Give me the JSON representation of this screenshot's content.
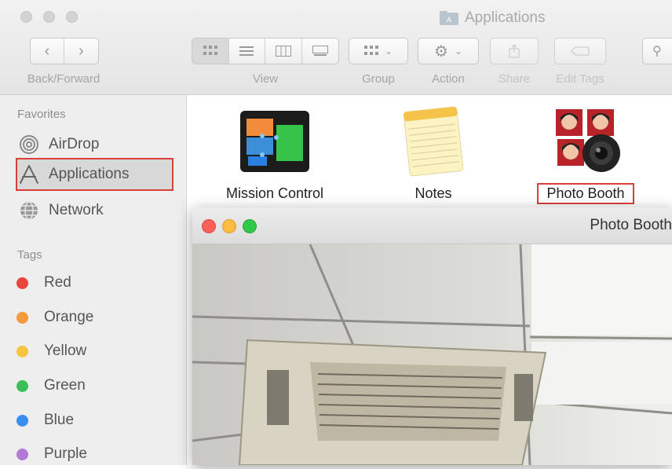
{
  "window": {
    "title": "Applications"
  },
  "toolbar": {
    "back_label": "Back/Forward",
    "view_label": "View",
    "group_label": "Group",
    "action_label": "Action",
    "share_label": "Share",
    "edit_tags_label": "Edit Tags"
  },
  "sidebar": {
    "favorites_header": "Favorites",
    "favorites": [
      {
        "label": "AirDrop",
        "icon": "airdrop-icon"
      },
      {
        "label": "Applications",
        "icon": "applications-icon"
      },
      {
        "label": "Network",
        "icon": "network-icon"
      }
    ],
    "tags_header": "Tags",
    "tags": [
      {
        "label": "Red",
        "color": "#e8453c"
      },
      {
        "label": "Orange",
        "color": "#f39a3d"
      },
      {
        "label": "Yellow",
        "color": "#f6c443"
      },
      {
        "label": "Green",
        "color": "#3bbf57"
      },
      {
        "label": "Blue",
        "color": "#3a8ef0"
      },
      {
        "label": "Purple",
        "color": "#b27ad6"
      }
    ]
  },
  "apps": [
    {
      "label": "Mission Control",
      "icon": "mission-control-icon"
    },
    {
      "label": "Notes",
      "icon": "notes-icon"
    },
    {
      "label": "Photo Booth",
      "icon": "photo-booth-icon"
    }
  ],
  "photo_booth_window": {
    "title": "Photo Booth"
  },
  "colors": {
    "highlight": "#d8403b",
    "close": "#fc605b",
    "minimize": "#fdbc40",
    "zoom": "#34c84a"
  }
}
